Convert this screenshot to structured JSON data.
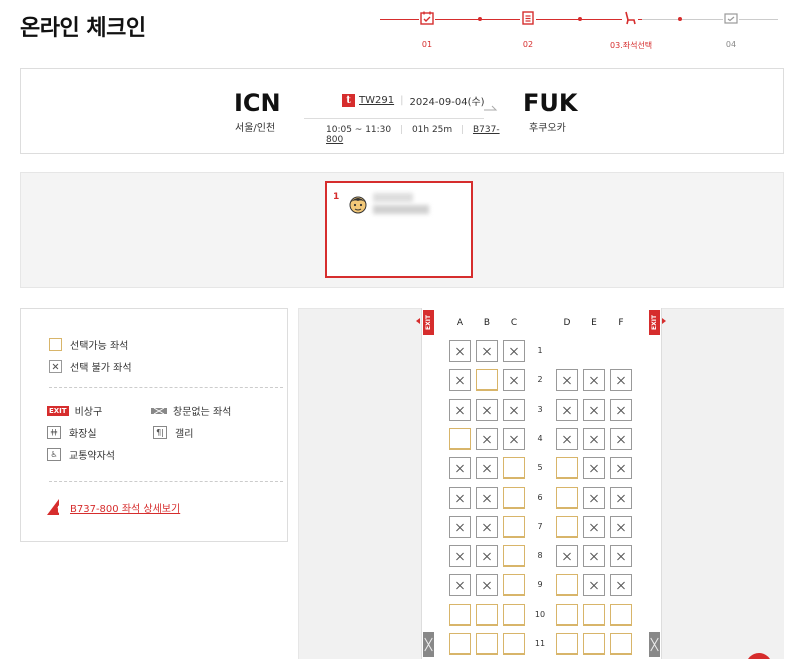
{
  "page": {
    "title": "온라인 체크인"
  },
  "stepper": {
    "steps": [
      {
        "label": "01",
        "icon": "calendar-check-icon",
        "active": true
      },
      {
        "label": "02",
        "icon": "document-list-icon",
        "active": true
      },
      {
        "label": "03.좌석선택",
        "icon": "seat-icon",
        "active": true
      },
      {
        "label": "04",
        "icon": "boarding-pass-icon",
        "active": false
      }
    ],
    "accent_color": "#d62d2d"
  },
  "flight": {
    "origin_code": "ICN",
    "origin_city": "서울/인천",
    "dest_code": "FUK",
    "dest_city": "후쿠오카",
    "airline_logo": "t",
    "flight_no": "TW291",
    "date": "2024-09-04(수)",
    "time": "10:05 ~ 11:30",
    "duration": "01h 25m",
    "aircraft": "B737-800"
  },
  "passenger": {
    "number": "1"
  },
  "legend": {
    "available": "선택가능 좌석",
    "unavailable": "선택 불가 좌석",
    "exit_badge": "EXIT",
    "exit": "비상구",
    "windowless": "창문없는 좌석",
    "toilet": "화장실",
    "galley": "갤리",
    "accessible": "교통약자석",
    "detail_link": "B737-800 좌석 상세보기"
  },
  "seatmap": {
    "exit_label": "EXIT",
    "columns": [
      "A",
      "B",
      "C",
      "D",
      "E",
      "F"
    ],
    "rows": [
      {
        "num": "1",
        "seats": [
          "x",
          "x",
          "x",
          null,
          null,
          null
        ]
      },
      {
        "num": "2",
        "seats": [
          "x",
          "o",
          "x",
          "x",
          "x",
          "x"
        ]
      },
      {
        "num": "3",
        "seats": [
          "x",
          "x",
          "x",
          "x",
          "x",
          "x"
        ]
      },
      {
        "num": "4",
        "seats": [
          "o",
          "x",
          "x",
          "x",
          "x",
          "x"
        ]
      },
      {
        "num": "5",
        "seats": [
          "x",
          "x",
          "o",
          "o",
          "x",
          "x"
        ]
      },
      {
        "num": "6",
        "seats": [
          "x",
          "x",
          "o",
          "o",
          "x",
          "x"
        ]
      },
      {
        "num": "7",
        "seats": [
          "x",
          "x",
          "o",
          "o",
          "x",
          "x"
        ]
      },
      {
        "num": "8",
        "seats": [
          "x",
          "x",
          "o",
          "x",
          "x",
          "x"
        ]
      },
      {
        "num": "9",
        "seats": [
          "x",
          "x",
          "o",
          "o",
          "x",
          "x"
        ]
      },
      {
        "num": "10",
        "seats": [
          "o",
          "o",
          "o",
          "o",
          "o",
          "o"
        ]
      },
      {
        "num": "11",
        "seats": [
          "o",
          "o",
          "o",
          "o",
          "o",
          "o"
        ]
      }
    ]
  }
}
